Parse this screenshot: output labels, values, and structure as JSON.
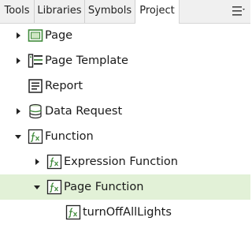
{
  "tabs": [
    {
      "label": "Tools",
      "active": false
    },
    {
      "label": "Libraries",
      "active": false
    },
    {
      "label": "Symbols",
      "active": false
    },
    {
      "label": "Project",
      "active": true
    }
  ],
  "menu_icon": "hamburger-menu-icon",
  "tree": [
    {
      "label": "Page",
      "icon": "page-icon",
      "expander": "collapsed",
      "depth": 0
    },
    {
      "label": "Page Template",
      "icon": "page-template-icon",
      "expander": "collapsed",
      "depth": 0
    },
    {
      "label": "Report",
      "icon": "report-icon",
      "expander": "none",
      "depth": 0
    },
    {
      "label": "Data Request",
      "icon": "database-icon",
      "expander": "collapsed",
      "depth": 0
    },
    {
      "label": "Function",
      "icon": "function-icon",
      "expander": "expanded",
      "depth": 0
    },
    {
      "label": "Expression Function",
      "icon": "function-icon",
      "expander": "collapsed",
      "depth": 1
    },
    {
      "label": "Page Function",
      "icon": "function-icon",
      "expander": "expanded",
      "depth": 1,
      "selected": true
    },
    {
      "label": "turnOffAllLights",
      "icon": "function-icon",
      "expander": "none",
      "depth": 2
    }
  ],
  "colors": {
    "selected_row": "#e2f1d7",
    "icon_green": "#3f8a3a",
    "tabbar_bg": "#f0f0f0"
  }
}
